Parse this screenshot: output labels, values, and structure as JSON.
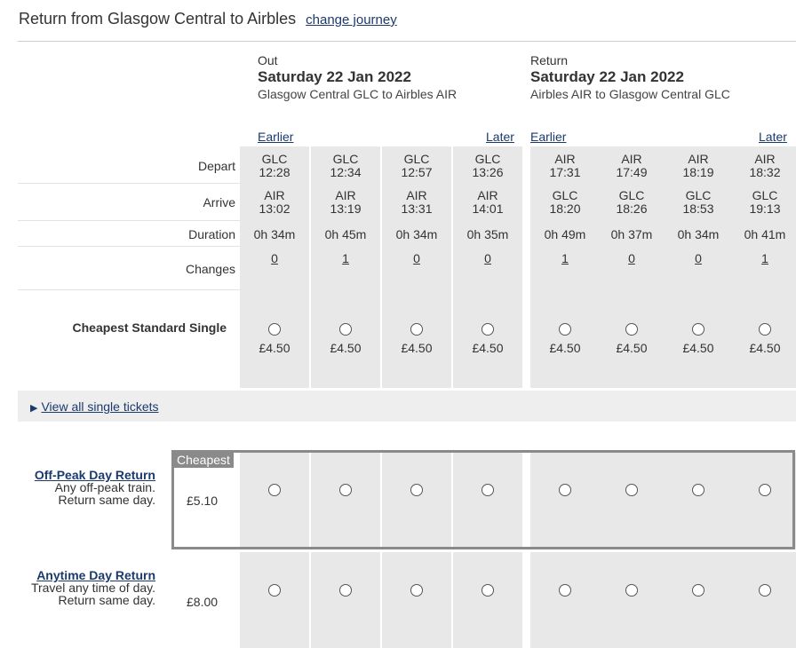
{
  "header": {
    "title": "Return from Glasgow Central to Airbles",
    "change_link": "change journey"
  },
  "out": {
    "label": "Out",
    "date": "Saturday 22 Jan 2022",
    "route": "Glasgow Central GLC to Airbles AIR",
    "earlier": "Earlier",
    "later": "Later"
  },
  "ret": {
    "label": "Return",
    "date": "Saturday 22 Jan 2022",
    "route": "Airbles AIR to Glasgow Central GLC",
    "earlier": "Earlier",
    "later": "Later"
  },
  "row_labels": {
    "depart": "Depart",
    "arrive": "Arrive",
    "duration": "Duration",
    "changes": "Changes",
    "cheapest_single": "Cheapest Standard Single"
  },
  "journeys": [
    {
      "dep_stn": "GLC",
      "dep_time": "12:28",
      "arr_stn": "AIR",
      "arr_time": "13:02",
      "duration": "0h 34m",
      "changes": "0",
      "price": "£4.50"
    },
    {
      "dep_stn": "GLC",
      "dep_time": "12:34",
      "arr_stn": "AIR",
      "arr_time": "13:19",
      "duration": "0h 45m",
      "changes": "1",
      "price": "£4.50"
    },
    {
      "dep_stn": "GLC",
      "dep_time": "12:57",
      "arr_stn": "AIR",
      "arr_time": "13:31",
      "duration": "0h 34m",
      "changes": "0",
      "price": "£4.50"
    },
    {
      "dep_stn": "GLC",
      "dep_time": "13:26",
      "arr_stn": "AIR",
      "arr_time": "14:01",
      "duration": "0h 35m",
      "changes": "0",
      "price": "£4.50"
    },
    {
      "dep_stn": "AIR",
      "dep_time": "17:31",
      "arr_stn": "GLC",
      "arr_time": "18:20",
      "duration": "0h 49m",
      "changes": "1",
      "price": "£4.50"
    },
    {
      "dep_stn": "AIR",
      "dep_time": "17:49",
      "arr_stn": "GLC",
      "arr_time": "18:26",
      "duration": "0h 37m",
      "changes": "0",
      "price": "£4.50"
    },
    {
      "dep_stn": "AIR",
      "dep_time": "18:19",
      "arr_stn": "GLC",
      "arr_time": "18:53",
      "duration": "0h 34m",
      "changes": "0",
      "price": "£4.50"
    },
    {
      "dep_stn": "AIR",
      "dep_time": "18:32",
      "arr_stn": "GLC",
      "arr_time": "19:13",
      "duration": "0h 41m",
      "changes": "1",
      "price": "£4.50"
    }
  ],
  "view_all": {
    "icon": "triangle-right-icon",
    "label": "View all single tickets"
  },
  "fares": [
    {
      "name": "Off-Peak Day Return",
      "line1": "Any off-peak train.",
      "line2": "Return same day.",
      "price": "£5.10",
      "tag": "Cheapest"
    },
    {
      "name": "Anytime Day Return",
      "line1": "Travel any time of day.",
      "line2": "Return same day.",
      "price": "£8.00",
      "tag": ""
    }
  ],
  "colors": {
    "link": "#1a3a6e",
    "cell_bg": "#e8e8e8",
    "cheapest_border": "#8a8a8a"
  }
}
